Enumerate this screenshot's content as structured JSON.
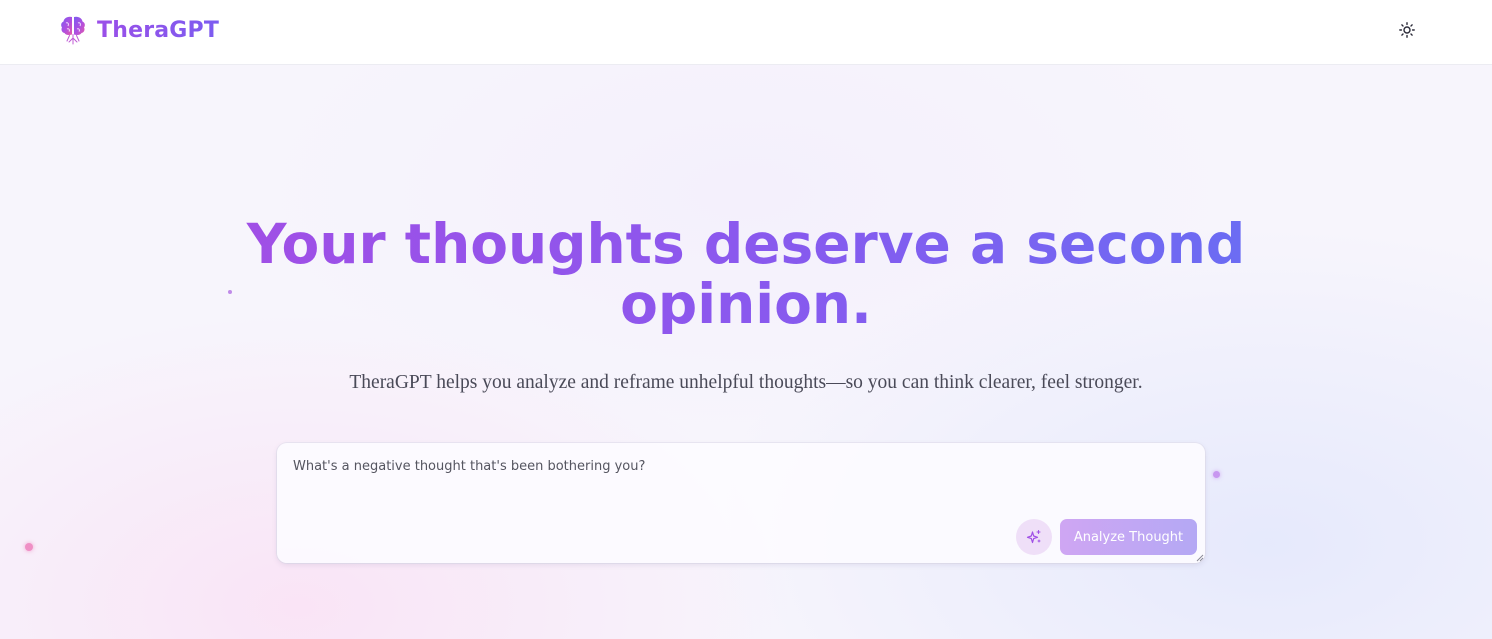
{
  "app": {
    "name": "TheraGPT"
  },
  "header": {
    "logo_icon": "brain-icon",
    "theme_toggle_icon": "sun-icon"
  },
  "hero": {
    "title": "Your thoughts deserve a second opinion.",
    "subtitle": "TheraGPT helps you analyze and reframe unhelpful thoughts—so you can think clearer, feel stronger."
  },
  "thought_form": {
    "input_placeholder": "What's a negative thought that's been bothering you?",
    "input_value": "",
    "sparkle_icon": "sparkles-icon",
    "submit_label": "Analyze Thought"
  },
  "colors": {
    "brand_purple": "#9b4fe8",
    "brand_indigo": "#6b6cf3",
    "button_start": "#cfa6f3",
    "button_end": "#b4a8f4",
    "sparkle_bg": "#efdff8"
  }
}
